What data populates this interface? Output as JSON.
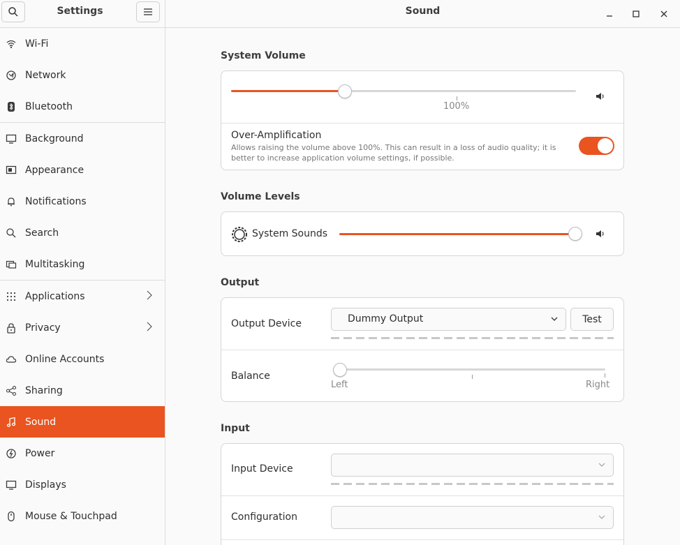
{
  "sidebar": {
    "title": "Settings",
    "items": [
      {
        "label": "Wi-Fi",
        "icon": "wifi-icon"
      },
      {
        "label": "Network",
        "icon": "network-icon"
      },
      {
        "label": "Bluetooth",
        "icon": "bluetooth-icon"
      },
      {
        "label": "Background",
        "icon": "background-icon"
      },
      {
        "label": "Appearance",
        "icon": "appearance-icon"
      },
      {
        "label": "Notifications",
        "icon": "bell-icon"
      },
      {
        "label": "Search",
        "icon": "search-icon"
      },
      {
        "label": "Multitasking",
        "icon": "multitasking-icon"
      },
      {
        "label": "Applications",
        "icon": "grid-icon"
      },
      {
        "label": "Privacy",
        "icon": "lock-icon"
      },
      {
        "label": "Online Accounts",
        "icon": "cloud-icon"
      },
      {
        "label": "Sharing",
        "icon": "share-icon"
      },
      {
        "label": "Sound",
        "icon": "music-note-icon"
      },
      {
        "label": "Power",
        "icon": "power-icon"
      },
      {
        "label": "Displays",
        "icon": "display-icon"
      },
      {
        "label": "Mouse & Touchpad",
        "icon": "mouse-icon"
      }
    ]
  },
  "window": {
    "title": "Sound"
  },
  "system_volume": {
    "title": "System Volume",
    "level_label": "100%",
    "level_fraction": 0.33,
    "over_amplification": {
      "label": "Over-Amplification",
      "description_line1": "Allows raising the volume above 100%. This can result in a loss of audio quality; it is",
      "description_line2": "better to increase application volume settings, if possible.",
      "enabled": true
    }
  },
  "volume_levels": {
    "title": "Volume Levels",
    "system_sounds": {
      "label": "System Sounds",
      "level_fraction": 1.0
    }
  },
  "output": {
    "title": "Output",
    "device_label": "Output Device",
    "device_value": "Dummy Output",
    "test_label": "Test",
    "balance_label": "Balance",
    "balance_left": "Left",
    "balance_right": "Right"
  },
  "input": {
    "title": "Input",
    "device_label": "Input Device",
    "configuration_label": "Configuration"
  },
  "colors": {
    "accent": "#e95420"
  }
}
